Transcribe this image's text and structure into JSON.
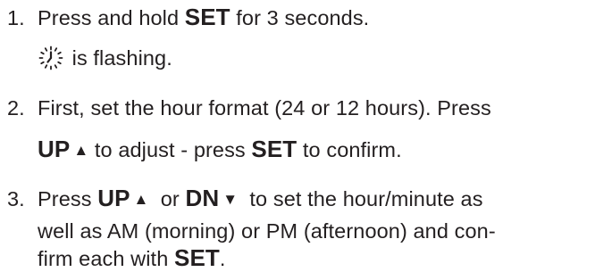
{
  "steps": [
    {
      "number": "1.",
      "line1": {
        "a": "Press and hold ",
        "b": "SET",
        "c": " for 3 seconds."
      },
      "line2": {
        "icon": "clock-icon",
        "text": " is flashing."
      }
    },
    {
      "number": "2.",
      "line1": "First, set the hour format (24 or 12 hours). Press",
      "line2": {
        "up": "UP",
        "up_arrow": "▲",
        "a": " to adjust - press ",
        "set": "SET",
        "b": " to confirm."
      }
    },
    {
      "number": "3.",
      "line1": {
        "a": "Press ",
        "up": "UP",
        "up_arrow": "▲",
        "or": "  or ",
        "dn": "DN",
        "dn_arrow": "▼",
        "b": "  to set the hour/minute as"
      },
      "line2": "well as AM (morning) or PM (afternoon) and con-",
      "line3": {
        "a": "firm each with ",
        "set": "SET",
        "b": "."
      }
    }
  ]
}
